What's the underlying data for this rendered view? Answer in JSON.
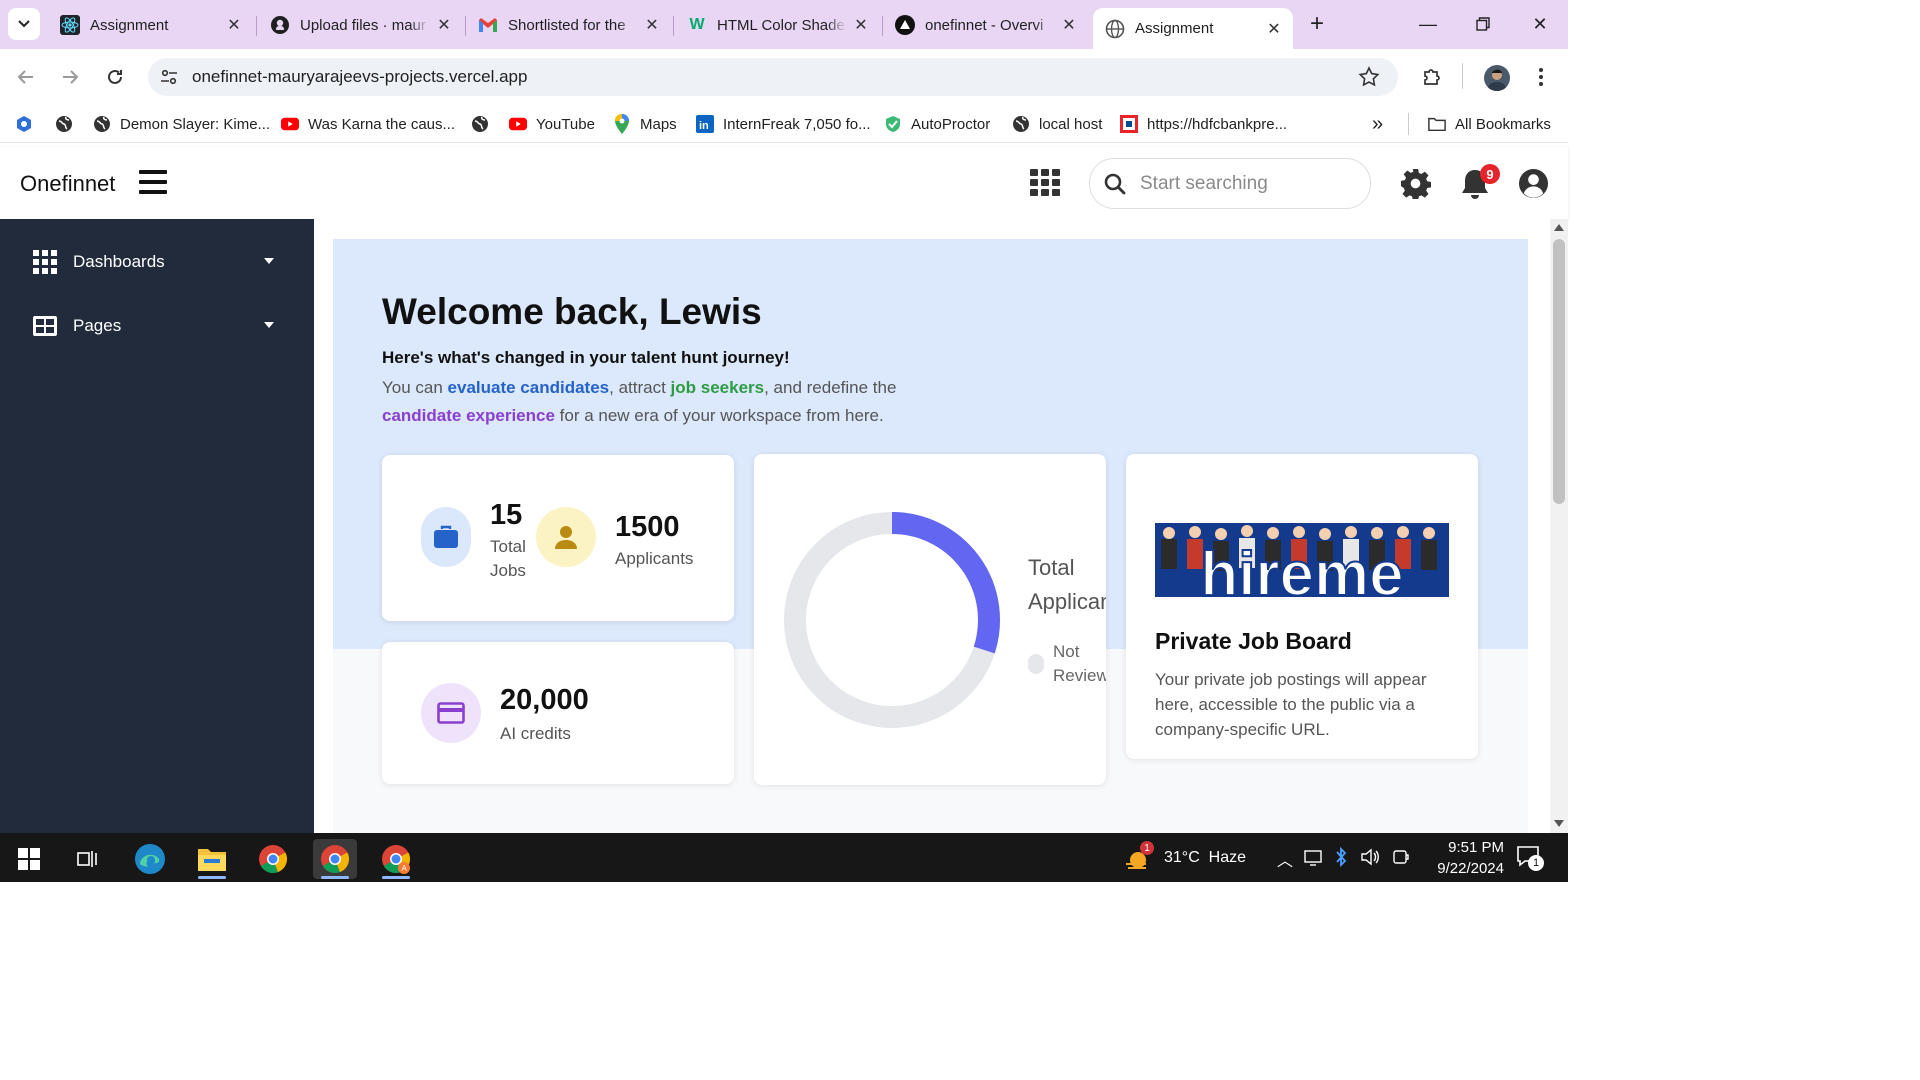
{
  "browser": {
    "tabs": [
      {
        "title": "Assignment",
        "icon": "react-icon",
        "active": false
      },
      {
        "title": "Upload files · maur",
        "icon": "github-icon",
        "active": false
      },
      {
        "title": "Shortlisted for the",
        "icon": "gmail-icon",
        "active": false
      },
      {
        "title": "HTML Color Shade",
        "icon": "w3-icon",
        "active": false
      },
      {
        "title": "onefinnet - Overvi",
        "icon": "vercel-icon",
        "active": false
      },
      {
        "title": "Assignment",
        "icon": "globe-icon",
        "active": true
      }
    ],
    "url": "onefinnet-mauryarajeevs-projects.vercel.app",
    "bookmarks": [
      {
        "label": "",
        "icon": "extension-bookmark-icon"
      },
      {
        "label": "",
        "icon": "globe-icon"
      },
      {
        "label": "Demon Slayer: Kime...",
        "icon": "globe-icon"
      },
      {
        "label": "Was Karna the caus...",
        "icon": "youtube-icon"
      },
      {
        "label": "",
        "icon": "globe-icon"
      },
      {
        "label": "YouTube",
        "icon": "youtube-icon"
      },
      {
        "label": "Maps",
        "icon": "maps-icon"
      },
      {
        "label": "InternFreak 7,050 fo...",
        "icon": "linkedin-icon"
      },
      {
        "label": "AutoProctor",
        "icon": "autoproctor-icon"
      },
      {
        "label": "local host",
        "icon": "globe-icon"
      },
      {
        "label": "https://hdfcbankpre...",
        "icon": "hdfc-icon"
      }
    ],
    "all_bookmarks": "All Bookmarks"
  },
  "app": {
    "brand": "Onefinnet",
    "search_placeholder": "Start searching",
    "notification_count": "9",
    "sidebar": [
      {
        "label": "Dashboards"
      },
      {
        "label": "Pages"
      }
    ]
  },
  "hero": {
    "title": "Welcome back, Lewis",
    "subtitle": "Here's what's changed in your talent hunt journey!",
    "desc_1": "You can ",
    "link_evaluate": "evaluate candidates",
    "desc_2": ", attract ",
    "link_seekers": "job seekers",
    "desc_3": ", and redefine the ",
    "link_experience": "candidate experience",
    "desc_4": " for a new era of your workspace from here."
  },
  "stats": {
    "total_jobs_value": "15",
    "total_jobs_label_1": "Total",
    "total_jobs_label_2": "Jobs",
    "applicants_value": "1500",
    "applicants_label": "Applicants",
    "credits_value": "20,000",
    "credits_label": "AI credits"
  },
  "chart_data": {
    "type": "pie",
    "title": "Total Applicants",
    "series": [
      {
        "name": "Not Reviewed",
        "value": 0.3,
        "color": "#6366f1"
      }
    ],
    "legend": [
      {
        "label": "Not Reviewed",
        "color": "#e5e7eb"
      }
    ]
  },
  "job_board": {
    "title": "Private Job Board",
    "text": "Your private job postings will appear here, accessible to the public via a company-specific URL.",
    "banner_text": "hireme"
  },
  "taskbar": {
    "weather": "31°C  Haze",
    "weather_badge": "1",
    "time": "9:51 PM",
    "date": "9/22/2024",
    "notif_badge": "1"
  },
  "colors": {
    "sidebar": "#212b3b",
    "hero_bg": "#dce8fb",
    "donut_fill": "#6366f1",
    "notif_badge": "#e5242b"
  }
}
